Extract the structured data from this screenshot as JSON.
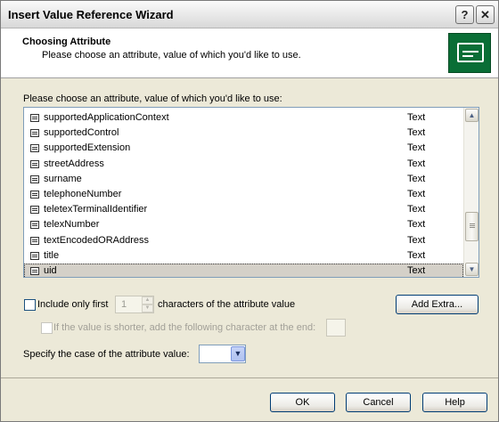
{
  "window": {
    "title": "Insert Value Reference Wizard",
    "help_glyph": "?",
    "close_glyph": "✕"
  },
  "header": {
    "title": "Choosing Attribute",
    "subtitle": "Please choose an attribute, value of which you'd like to use.",
    "icon": "wizard-card-icon"
  },
  "attribute_list": {
    "label": "Please choose an attribute, value of which you'd like to use:",
    "rows": [
      {
        "name": "supportedApplicationContext",
        "type": "Text"
      },
      {
        "name": "supportedControl",
        "type": "Text"
      },
      {
        "name": "supportedExtension",
        "type": "Text"
      },
      {
        "name": "streetAddress",
        "type": "Text"
      },
      {
        "name": "surname",
        "type": "Text"
      },
      {
        "name": "telephoneNumber",
        "type": "Text"
      },
      {
        "name": "teletexTerminalIdentifier",
        "type": "Text"
      },
      {
        "name": "telexNumber",
        "type": "Text"
      },
      {
        "name": "textEncodedORAddress",
        "type": "Text"
      },
      {
        "name": "title",
        "type": "Text"
      },
      {
        "name": "uid",
        "type": "Text",
        "selected": true
      }
    ]
  },
  "options": {
    "include_first_label": "Include only first",
    "include_first_checked": false,
    "include_first_count": "1",
    "characters_label": "characters of the attribute value",
    "add_extra_label": "Add Extra...",
    "if_shorter_label": "If the value is shorter, add the following character at the end:",
    "if_shorter_checked": false,
    "pad_character": "",
    "case_label": "Specify the case of the attribute value:",
    "case_value": ""
  },
  "footer": {
    "ok_label": "OK",
    "cancel_label": "Cancel",
    "help_label": "Help"
  },
  "colors": {
    "window_bg": "#ece9d8",
    "header_bg": "#ffffff",
    "icon_green": "#0a6e36",
    "selected_row": "#d4d0c8",
    "button_border": "#003c74"
  }
}
